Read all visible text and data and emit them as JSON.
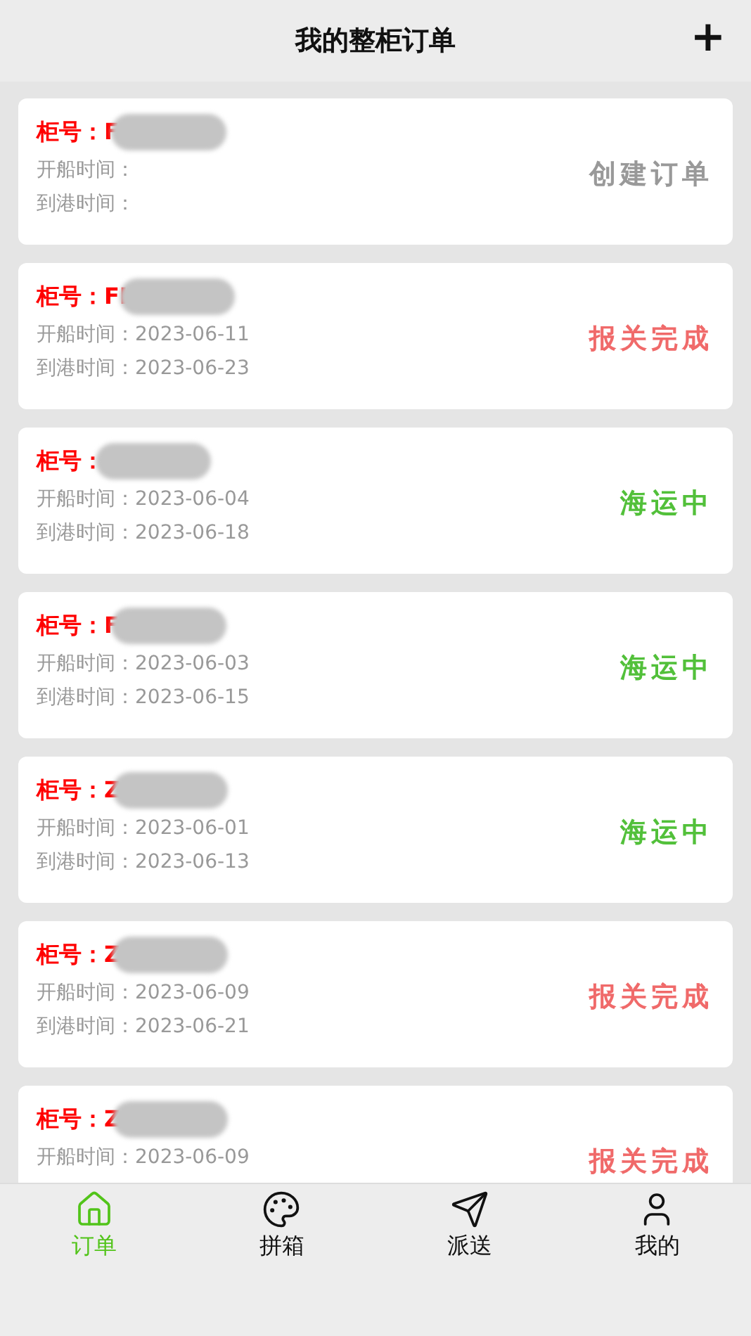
{
  "header": {
    "title": "我的整柜订单",
    "add_button": "+"
  },
  "orders": [
    {
      "container": "柜号：F",
      "departure_label": "开船时间：",
      "arrival_label": "到港时间：",
      "status": {
        "kind": "created",
        "text": "创建订单"
      }
    },
    {
      "container": "柜号：FI",
      "departure_label": "开船时间：",
      "departure": "2023-06-11",
      "arrival_label": "到港时间：",
      "arrival": "2023-06-23",
      "status": {
        "kind": "customs",
        "text": "报关完成"
      }
    },
    {
      "container": "柜号：",
      "departure_label": "开船时间：",
      "departure": "2023-06-04",
      "arrival_label": "到港时间：",
      "arrival": "2023-06-18",
      "status": {
        "kind": "shipping",
        "text": "海运中"
      }
    },
    {
      "container": "柜号：F",
      "departure_label": "开船时间：",
      "departure": "2023-06-03",
      "arrival_label": "到港时间：",
      "arrival": "2023-06-15",
      "status": {
        "kind": "shipping",
        "text": "海运中"
      }
    },
    {
      "container": "柜号：Z",
      "departure_label": "开船时间：",
      "departure": "2023-06-01",
      "arrival_label": "到港时间：",
      "arrival": "2023-06-13",
      "status": {
        "kind": "shipping",
        "text": "海运中"
      }
    },
    {
      "container": "柜号：Z",
      "departure_label": "开船时间：",
      "departure": "2023-06-09",
      "arrival_label": "到港时间：",
      "arrival": "2023-06-21",
      "status": {
        "kind": "customs",
        "text": "报关完成"
      }
    },
    {
      "container": "柜号：Z",
      "departure_label": "开船时间：",
      "departure": "2023-06-09",
      "status": {
        "kind": "customs",
        "text": "报关完成"
      }
    }
  ],
  "tab_bar": [
    {
      "kind": "home",
      "label": "订单",
      "selected": true
    },
    {
      "kind": "palette",
      "label": "拼箱",
      "selected": false
    },
    {
      "kind": "send",
      "label": "派送",
      "selected": false
    },
    {
      "kind": "user",
      "label": "我的",
      "selected": false
    }
  ]
}
